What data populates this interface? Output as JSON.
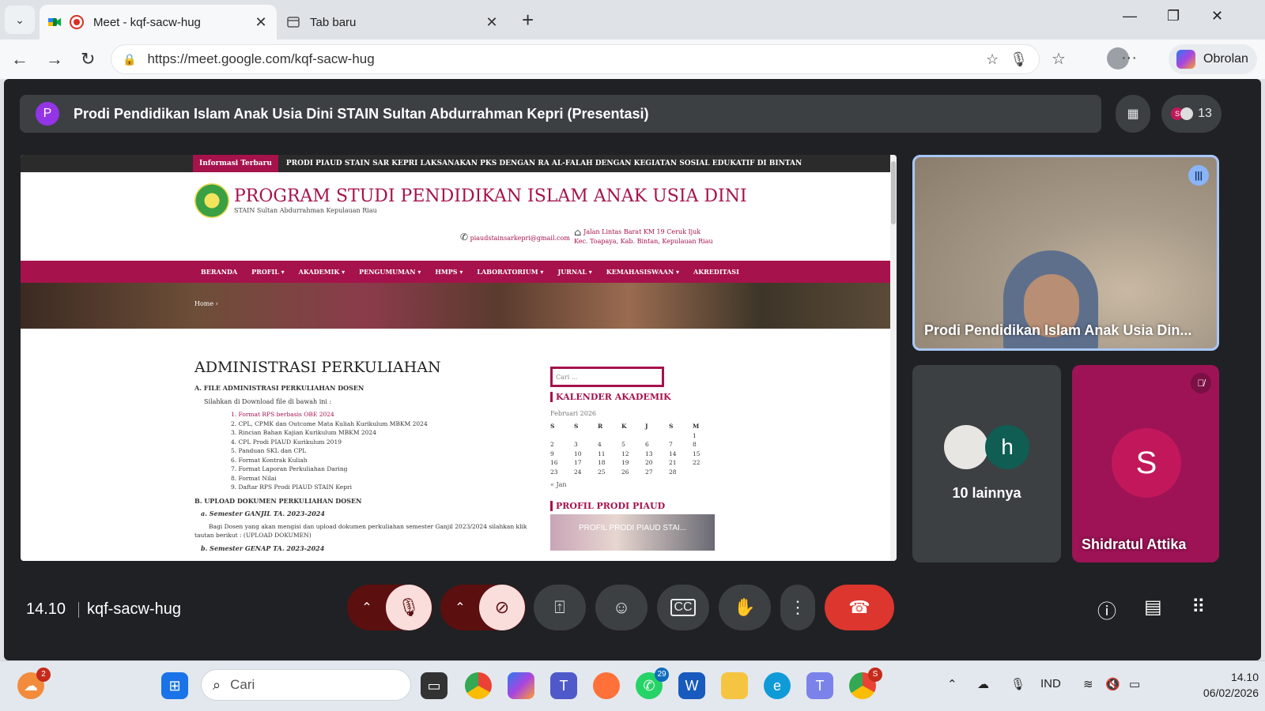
{
  "browser": {
    "active_tab": {
      "title": "Meet - kqf-sacw-hug"
    },
    "inactive_tab": {
      "title": "Tab baru"
    },
    "url": "https://meet.google.com/kqf-sacw-hug",
    "copilot_label": "Obrolan"
  },
  "meeting": {
    "title_avatar": "P",
    "title": "Prodi Pendidikan Islam Anak Usia Dini STAIN Sultan Abdurrahman Kepri (Presentasi)",
    "participant_count": "13",
    "time": "14.10",
    "code": "kqf-sacw-hug"
  },
  "presentation": {
    "news_label": "Informasi Terbaru",
    "news_text": "PRODI PIAUD STAIN SAR KEPRI LAKSANAKAN PKS DENGAN RA AL-FALAH DENGAN KEGIATAN SOSIAL EDUKATIF DI BINTAN",
    "site_title": "PROGRAM STUDI PENDIDIKAN ISLAM ANAK USIA DINI",
    "site_subtitle": "STAIN Sultan Abdurrahman Kepulauan Riau",
    "email": "piaudstainsarkepri@gmail.com",
    "address_1": "Jalan Lintas Barat KM 19 Ceruk Ijuk",
    "address_2": "Kec. Toapaya, Kab. Bintan, Kepulauan Riau",
    "nav": [
      "BERANDA",
      "PROFIL ▾",
      "AKADEMIK ▾",
      "PENGUMUMAN ▾",
      "HMPS ▾",
      "LABORATORIUM ▾",
      "JURNAL ▾",
      "KEMAHASISWAAN ▾",
      "AKREDITASI"
    ],
    "crumb": "Home  ›",
    "heading": "ADMINISTRASI PERKULIAHAN",
    "section_a": "A. FILE ADMINISTRASI PERKULIAHAN DOSEN",
    "intro": "Silahkan di Download file di bawah ini :",
    "files": [
      "1. Format RPS berbasis OBE 2024",
      "2. CPL, CPMK dan Outcome Mata Kuliah Kurikulum MBKM 2024",
      "3. Rincian Bahan Kajian Kurikulum MBKM 2024",
      "4. CPL Prodi PIAUD Kurikulum 2019",
      "5. Panduan SKL dan CPL",
      "6. Format Kontrak Kuliah",
      "7. Format Laporan Perkuliahan Daring",
      "8. Format Nilai",
      "9. Daftar RPS Prodi PIAUD STAIN Kepri"
    ],
    "section_b": "B. UPLOAD DOKUMEN PERKULIAHAN DOSEN",
    "sem_a": "a. Semester GANJIL TA. 2023-2024",
    "sem_a_text": "Bagi Dosen yang akan mengisi dan upload dokumen perkuliahan semester Ganjil 2023/2024 silahkan klik tautan berikut : (UPLOAD DOKUMEN)",
    "sem_b": "b. Semester GENAP TA. 2023-2024",
    "search_placeholder": "Cari ...",
    "calendar_heading": "KALENDER AKADEMIK",
    "calendar_month": "Februari 2026",
    "calendar_days": [
      "S",
      "S",
      "R",
      "K",
      "J",
      "S",
      "M"
    ],
    "calendar_rows": [
      [
        "",
        "",
        "",
        "",
        "",
        "",
        "1"
      ],
      [
        "2",
        "3",
        "4",
        "5",
        "6",
        "7",
        "8"
      ],
      [
        "9",
        "10",
        "11",
        "12",
        "13",
        "14",
        "15"
      ],
      [
        "16",
        "17",
        "18",
        "19",
        "20",
        "21",
        "22"
      ],
      [
        "23",
        "24",
        "25",
        "26",
        "27",
        "28",
        ""
      ]
    ],
    "calendar_prev": "« Jan",
    "profile_heading": "PROFIL PRODI PIAUD",
    "video_title": "PROFIL PRODI PIAUD STAI..."
  },
  "participants": {
    "main_name": "Prodi Pendidikan Islam Anak Usia Din...",
    "others_avatar": "h",
    "others_label": "10 lainnya",
    "shid_initial": "S",
    "shid_name": "Shidratul Attika"
  },
  "taskbar": {
    "search_label": "Cari",
    "whatsapp_badge": "29",
    "weather_badge": "2",
    "chrome_badge": "S",
    "lang": "IND",
    "time": "14.10",
    "date": "06/02/2026"
  },
  "colors": {
    "accent": "#a6124b",
    "meet_bg": "#202124",
    "end_call": "#dc362e"
  }
}
